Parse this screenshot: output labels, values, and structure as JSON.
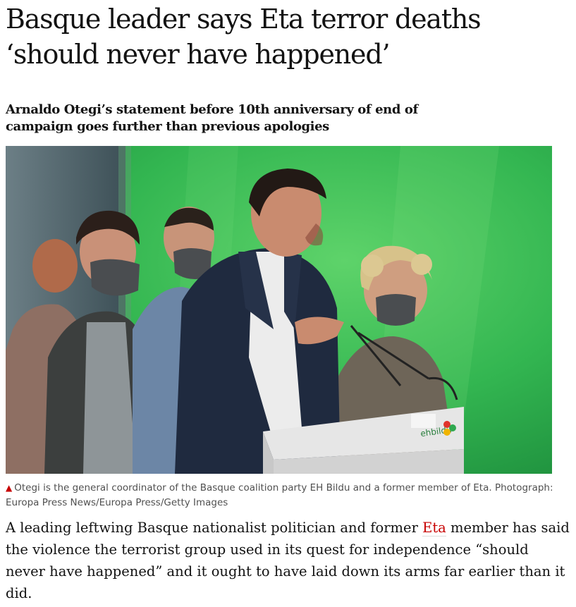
{
  "article": {
    "headline": "Basque leader says Eta terror deaths ‘should never have happened’",
    "standfirst": "Arnaldo Otegi’s statement before 10th anniversary of end of campaign goes further than previous apologies",
    "image": {
      "description": "Otegi speaking at an EH Bildu lectern against a green backdrop, with masked supporters behind him",
      "podium_logo": "ehbildu",
      "alt_icon": "ehbildu-logo-icon"
    },
    "caption": {
      "icon": "triangle-up-icon",
      "text": "Otegi is the general coordinator of the Basque coalition party EH Bildu and a former member of Eta. Photograph: Europa Press News/Europa Press/Getty Images"
    },
    "body": {
      "before_link": "A leading leftwing Basque nationalist politician and former ",
      "link_text": "Eta",
      "after_link": " member has said the violence the terrorist group used in its quest for independence “should never have happened” and it ought to have laid down its arms far earlier than it did."
    }
  },
  "colors": {
    "text": "#121212",
    "link": "#c70000",
    "caption": "#505050",
    "caption_icon": "#c70000",
    "photo_backdrop": "#2fb34f"
  }
}
